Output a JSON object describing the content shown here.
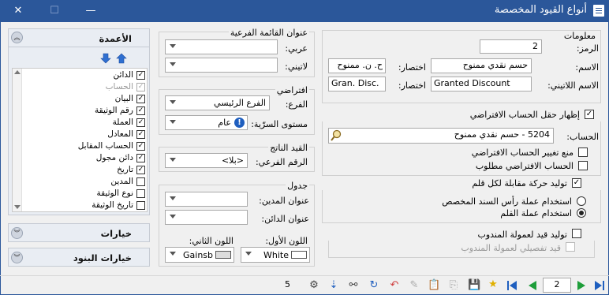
{
  "window": {
    "title": "أنواع القيود المخصصة",
    "minimize": "—",
    "maximize": "☐",
    "close": "✕"
  },
  "left": {
    "columns_header": "الأعمدة",
    "columns": [
      {
        "label": "الدائن",
        "checked": true,
        "enabled": true
      },
      {
        "label": "الحساب",
        "checked": true,
        "enabled": false
      },
      {
        "label": "البيان",
        "checked": true,
        "enabled": true
      },
      {
        "label": "رقم الوثيقة",
        "checked": true,
        "enabled": true
      },
      {
        "label": "العملة",
        "checked": true,
        "enabled": true
      },
      {
        "label": "المعادل",
        "checked": true,
        "enabled": true
      },
      {
        "label": "الحساب المقابل",
        "checked": true,
        "enabled": true
      },
      {
        "label": "دائن مجول",
        "checked": true,
        "enabled": true
      },
      {
        "label": "تاريخ",
        "checked": true,
        "enabled": true
      },
      {
        "label": "المدين",
        "checked": false,
        "enabled": true
      },
      {
        "label": "نوع الوثيقة",
        "checked": false,
        "enabled": true
      },
      {
        "label": "تاريخ الوثيقة",
        "checked": false,
        "enabled": true
      }
    ],
    "options_header": "خيارات",
    "items_options_header": "خيارات البنود"
  },
  "info": {
    "title": "معلومات",
    "code_label": "الرمز:",
    "code_value": "2",
    "name_label": "الاسم:",
    "name_value": "حسم نقدي ممنوح",
    "abbr_label": "اختصار:",
    "abbr_value": "ح. ن. ممنوح",
    "latin_name_label": "الاسم اللاتيني:",
    "latin_name_value": "Granted Discount",
    "latin_abbr_label": "اختصار:",
    "latin_abbr_value": "Gran. Disc."
  },
  "default_account": {
    "show_label": "إظهار حقل الحساب الافتراضي",
    "show_checked": true,
    "account_label": "الحساب:",
    "account_value": "5204 - حسم نقدي ممنوح",
    "prevent_change_label": "منع تغيير الحساب الافتراضي",
    "required_label": "الحساب الافتراضي مطلوب"
  },
  "contra": {
    "generate_label": "توليد حركة مقابلة لكل قلم",
    "generate_checked": true,
    "option1": "استخدام عملة رأس السند المخصص",
    "option2": "استخدام عملة القلم"
  },
  "agent": {
    "generate_label": "توليد قيد لعمولة المندوب",
    "detail_label": "قيد تفصيلي لعمولة المندوب"
  },
  "sub_menu": {
    "title": "عنوان القائمة الفرعية",
    "arabic_label": "عربي:",
    "latin_label": "لاتيني:"
  },
  "defaults": {
    "title": "افتراضي",
    "branch_label": "الفرع:",
    "branch_value": "الفرع الرئيسي",
    "security_label": "مستوى السرّية:",
    "security_value": "عام"
  },
  "result_entry": {
    "title": "القيد الناتج",
    "subnumber_label": "الرقم الفرعي:",
    "subnumber_value": "<بلا>"
  },
  "table": {
    "title": "جدول",
    "debit_title_label": "عنوان المدين:",
    "credit_title_label": "عنوان الدائن:",
    "color1_label": "اللون الأول:",
    "color1_value": "White",
    "color1_hex": "#ffffff",
    "color2_label": "اللون الثاني:",
    "color2_value": "Gainsb",
    "color2_hex": "#dcdcdc"
  },
  "toolbar": {
    "record_count": "5",
    "current_record": "2"
  },
  "colors": {
    "title_bar": "#2b579a",
    "nav_green": "#1e9e3a",
    "nav_blue": "#1f5fbf"
  }
}
